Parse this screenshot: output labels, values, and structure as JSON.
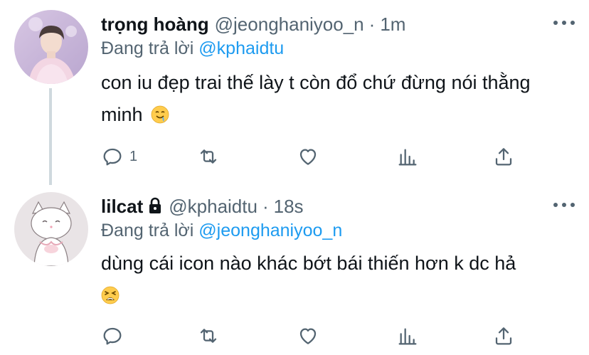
{
  "tweets": [
    {
      "name": "trọng hoàng",
      "handle": "@jeonghaniyoo_n",
      "separator": "·",
      "time": "1m",
      "reply_prefix": "Đang trả lời",
      "reply_to": "@kphaidtu",
      "text": "con iu đẹp trai thế lày t còn đổ chứ đừng nói thằng minh",
      "emoji": "drooling-face-emoji",
      "avatar": "avatar-photo-person-pink-sweater",
      "reply_count": "1",
      "locked": false
    },
    {
      "name": "lilcat",
      "handle": "@kphaidtu",
      "separator": "·",
      "time": "18s",
      "reply_prefix": "Đang trả lời",
      "reply_to": "@jeonghaniyoo_n",
      "text": "dùng cái icon nào khác bớt bái thiến hơn k dc hả",
      "emoji": "tired-face-emoji",
      "avatar": "avatar-drawing-cat",
      "reply_count": "",
      "locked": true
    }
  ],
  "colors": {
    "text": "#0f1419",
    "secondary": "#536471",
    "link": "#1d9bf0",
    "thread_line": "#cfd9de"
  }
}
